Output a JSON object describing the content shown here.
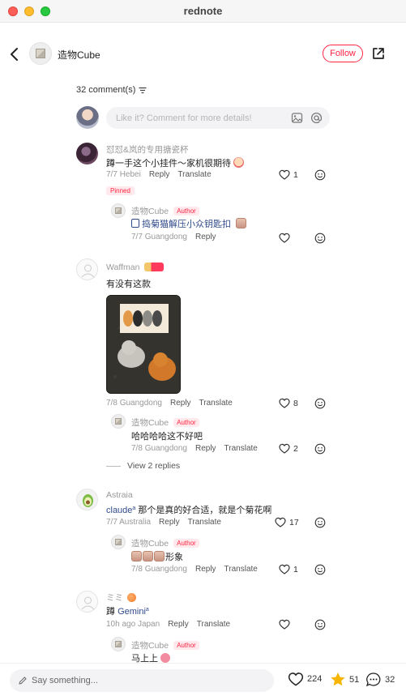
{
  "window": {
    "title": "rednote"
  },
  "header": {
    "author": "造物Cube",
    "follow_label": "Follow"
  },
  "comments_header": {
    "count_label": "32 comment(s)"
  },
  "comment_input": {
    "placeholder": "Like it? Comment for more details!"
  },
  "actions": {
    "reply": "Reply",
    "translate": "Translate"
  },
  "comments": [
    {
      "user": "怼怼&岚的专用搪瓷杯",
      "text": "蹲一手这个小挂件～家机很期待",
      "date": "7/7",
      "location": "Hebei",
      "likes": "1",
      "pinned": "Pinned",
      "reply": {
        "user": "造物Cube",
        "badge": "Author",
        "text": "捣菊猫解压小众钥匙扣",
        "date": "7/7",
        "location": "Guangdong"
      }
    },
    {
      "user": "Waffman",
      "text": "有没有这款",
      "date": "7/8",
      "location": "Guangdong",
      "likes": "8",
      "reply": {
        "user": "造物Cube",
        "badge": "Author",
        "text": "哈哈哈哈这不好吧",
        "date": "7/8",
        "location": "Guangdong",
        "likes": "2"
      },
      "view_replies": "View 2 replies"
    },
    {
      "user": "Astraia",
      "mention": "claude",
      "text": "那个是真的好合适，就是个菊花啊",
      "date": "7/7",
      "location": "Australia",
      "likes": "17",
      "reply": {
        "user": "造物Cube",
        "badge": "Author",
        "text": "形象",
        "date": "7/8",
        "location": "Guangdong",
        "likes": "1"
      }
    },
    {
      "user": "ミミ",
      "text": "蹲",
      "mention": "Gemini",
      "date": "10h ago",
      "location": "Japan",
      "reply": {
        "user": "造物Cube",
        "badge": "Author",
        "text": "马上上"
      }
    }
  ],
  "bottom_bar": {
    "say_placeholder": "Say something...",
    "likes": "224",
    "stars": "51",
    "comments": "32"
  },
  "colors": {
    "accent": "#ff2442",
    "mention": "#2f4a8a",
    "muted": "#999999"
  }
}
